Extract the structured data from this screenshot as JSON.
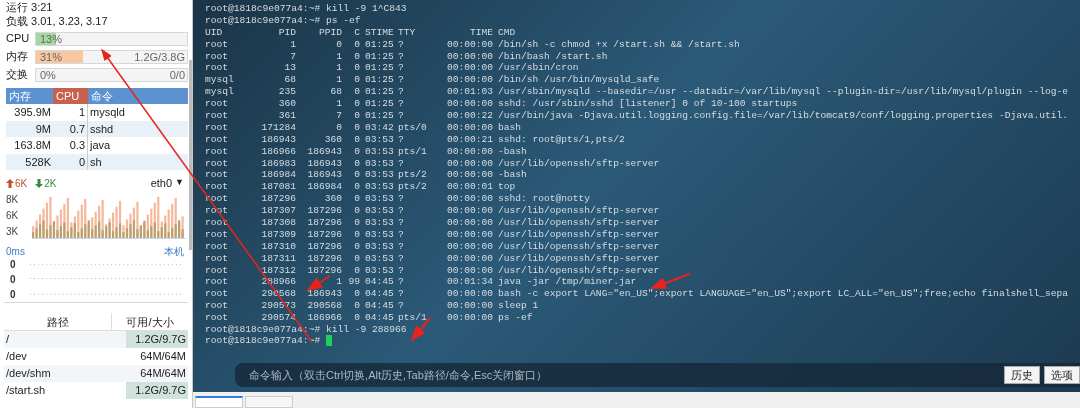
{
  "sidebar": {
    "uptime": "运行 3:21",
    "load": "负载 3.01, 3.23, 3.17",
    "meters": [
      {
        "label": "CPU",
        "value": "13%",
        "level": 0.13,
        "kind": "cpu"
      },
      {
        "label": "内存",
        "value": "31%",
        "detail": "1.2G/3.8G",
        "level": 0.31,
        "kind": "mem"
      },
      {
        "label": "交换",
        "value": "0%",
        "detail": "0/0",
        "level": 0,
        "kind": "swap"
      }
    ],
    "process_table": {
      "columns": [
        {
          "label": "内存",
          "sorted": false
        },
        {
          "label": "CPU",
          "sorted": true
        },
        {
          "label": "命令",
          "sorted": false
        }
      ],
      "rows": [
        {
          "mem": "395.9M",
          "cpu": "1",
          "cmd": "mysqld"
        },
        {
          "mem": "9M",
          "cpu": "0.7",
          "cmd": "sshd"
        },
        {
          "mem": "163.8M",
          "cpu": "0.3",
          "cmd": "java"
        },
        {
          "mem": "528K",
          "cpu": "0",
          "cmd": "sh"
        }
      ]
    },
    "network": {
      "up": "6K",
      "down": "2K",
      "interface": "eth0",
      "dropdown": "▼",
      "y_labels": [
        "8K",
        "6K",
        "3K"
      ]
    },
    "ping": {
      "latency": "0ms",
      "target": "本机",
      "y_labels": [
        "0",
        "0",
        "0"
      ]
    },
    "disk_table": {
      "columns": [
        "路径",
        "可用/大小"
      ],
      "rows": [
        {
          "path": "/",
          "size": "1.2G/9.7G",
          "highlight": true
        },
        {
          "path": "/dev",
          "size": "64M/64M",
          "highlight": false
        },
        {
          "path": "/dev/shm",
          "size": "64M/64M",
          "highlight": false
        },
        {
          "path": "/start.sh",
          "size": "1.2G/9.7G",
          "highlight": true
        }
      ]
    }
  },
  "terminal": {
    "lines": [
      {
        "kind": "text",
        "text": "root@1818c9e077a4:~# kill -9 1^C843"
      },
      {
        "kind": "text",
        "text": "root@1818c9e077a4:~# ps -ef"
      },
      {
        "kind": "row",
        "cells": [
          "UID",
          "PID",
          "PPID",
          "C",
          "STIME",
          "TTY",
          "TIME",
          "CMD"
        ]
      },
      {
        "kind": "row",
        "cells": [
          "root",
          "1",
          "0",
          "0",
          "01:25",
          "?",
          "00:00:00",
          "/bin/sh -c chmod +x /start.sh && /start.sh"
        ]
      },
      {
        "kind": "row",
        "cells": [
          "root",
          "7",
          "1",
          "0",
          "01:25",
          "?",
          "00:00:00",
          "/bin/bash /start.sh"
        ]
      },
      {
        "kind": "row",
        "cells": [
          "root",
          "13",
          "1",
          "0",
          "01:25",
          "?",
          "00:00:00",
          "/usr/sbin/cron"
        ]
      },
      {
        "kind": "row",
        "cells": [
          "mysql",
          "68",
          "1",
          "0",
          "01:25",
          "?",
          "00:00:00",
          "/bin/sh /usr/bin/mysqld_safe"
        ]
      },
      {
        "kind": "row",
        "cells": [
          "mysql",
          "235",
          "68",
          "0",
          "01:25",
          "?",
          "00:01:03",
          "/usr/sbin/mysqld --basedir=/usr --datadir=/var/lib/mysql --plugin-dir=/usr/lib/mysql/plugin --log-e"
        ]
      },
      {
        "kind": "row",
        "cells": [
          "root",
          "360",
          "1",
          "0",
          "01:25",
          "?",
          "00:00:00",
          "sshd: /usr/sbin/sshd [listener] 0 of 10-100 startups"
        ]
      },
      {
        "kind": "row",
        "cells": [
          "root",
          "361",
          "7",
          "0",
          "01:25",
          "?",
          "00:00:22",
          "/usr/bin/java -Djava.util.logging.config.file=/var/lib/tomcat9/conf/logging.properties -Djava.util."
        ]
      },
      {
        "kind": "row",
        "cells": [
          "root",
          "171284",
          "0",
          "0",
          "03:42",
          "pts/0",
          "00:00:00",
          "bash"
        ]
      },
      {
        "kind": "row",
        "cells": [
          "root",
          "186943",
          "360",
          "0",
          "03:53",
          "?",
          "00:00:21",
          "sshd: root@pts/1,pts/2"
        ]
      },
      {
        "kind": "row",
        "cells": [
          "root",
          "186966",
          "186943",
          "0",
          "03:53",
          "pts/1",
          "00:00:00",
          "-bash"
        ]
      },
      {
        "kind": "row",
        "cells": [
          "root",
          "186983",
          "186943",
          "0",
          "03:53",
          "?",
          "00:00:00",
          "/usr/lib/openssh/sftp-server"
        ]
      },
      {
        "kind": "row",
        "cells": [
          "root",
          "186984",
          "186943",
          "0",
          "03:53",
          "pts/2",
          "00:00:00",
          "-bash"
        ]
      },
      {
        "kind": "row",
        "cells": [
          "root",
          "187081",
          "186984",
          "0",
          "03:53",
          "pts/2",
          "00:00:01",
          "top"
        ]
      },
      {
        "kind": "row",
        "cells": [
          "root",
          "187296",
          "360",
          "0",
          "03:53",
          "?",
          "00:00:00",
          "sshd: root@notty"
        ]
      },
      {
        "kind": "row",
        "cells": [
          "root",
          "187307",
          "187296",
          "0",
          "03:53",
          "?",
          "00:00:00",
          "/usr/lib/openssh/sftp-server"
        ]
      },
      {
        "kind": "row",
        "cells": [
          "root",
          "187308",
          "187296",
          "0",
          "03:53",
          "?",
          "00:00:00",
          "/usr/lib/openssh/sftp-server"
        ]
      },
      {
        "kind": "row",
        "cells": [
          "root",
          "187309",
          "187296",
          "0",
          "03:53",
          "?",
          "00:00:00",
          "/usr/lib/openssh/sftp-server"
        ]
      },
      {
        "kind": "row",
        "cells": [
          "root",
          "187310",
          "187296",
          "0",
          "03:53",
          "?",
          "00:00:00",
          "/usr/lib/openssh/sftp-server"
        ]
      },
      {
        "kind": "row",
        "cells": [
          "root",
          "187311",
          "187296",
          "0",
          "03:53",
          "?",
          "00:00:00",
          "/usr/lib/openssh/sftp-server"
        ]
      },
      {
        "kind": "row",
        "cells": [
          "root",
          "187312",
          "187296",
          "0",
          "03:53",
          "?",
          "00:00:00",
          "/usr/lib/openssh/sftp-server"
        ]
      },
      {
        "kind": "row",
        "cells": [
          "root",
          "288966",
          "1",
          "99",
          "04:45",
          "?",
          "00:01:34",
          "java -jar /tmp/miner.jar"
        ]
      },
      {
        "kind": "row",
        "cells": [
          "root",
          "290568",
          "186943",
          "0",
          "04:45",
          "?",
          "00:00:00",
          "bash -c export LANG=\"en_US\";export LANGUAGE=\"en_US\";export LC_ALL=\"en_US\";free;echo finalshell_sepa"
        ]
      },
      {
        "kind": "row",
        "cells": [
          "root",
          "290573",
          "290568",
          "0",
          "04:45",
          "?",
          "00:00:00",
          "sleep 1"
        ]
      },
      {
        "kind": "row",
        "cells": [
          "root",
          "290574",
          "186966",
          "0",
          "04:45",
          "pts/1",
          "00:00:00",
          "ps -ef"
        ]
      },
      {
        "kind": "text",
        "text": "root@1818c9e077a4:~# kill -9 288966"
      },
      {
        "kind": "prompt",
        "text": "root@1818c9e077a4:~#",
        "cursor": true
      }
    ]
  },
  "command_bar": {
    "placeholder": "命令输入（双击Ctrl切换,Alt历史,Tab路径/命令,Esc关闭窗口）",
    "buttons": [
      "历史",
      "选项"
    ]
  },
  "bottom_tabs": [
    {
      "selected": true
    },
    {
      "selected": false
    }
  ]
}
